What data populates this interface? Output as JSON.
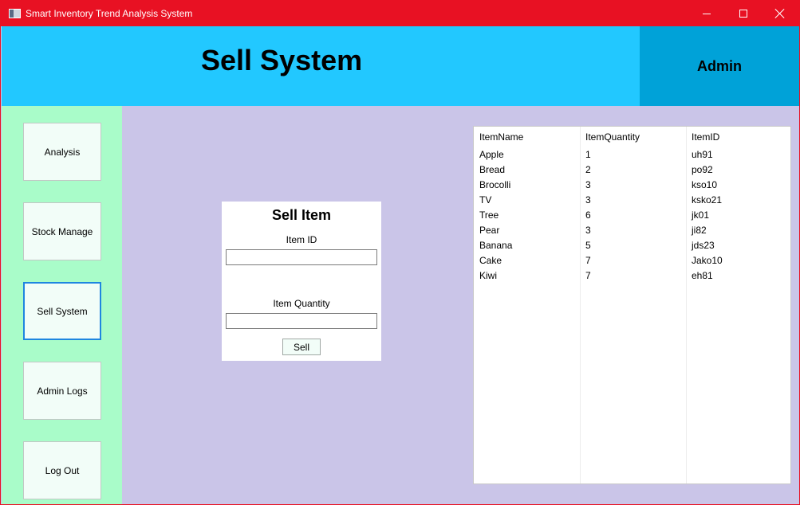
{
  "window": {
    "title": "Smart Inventory Trend Analysis System"
  },
  "header": {
    "title": "Sell System",
    "user_label": "Admin"
  },
  "sidebar": {
    "items": [
      {
        "label": "Analysis"
      },
      {
        "label": "Stock Manage"
      },
      {
        "label": "Sell System",
        "active": true
      },
      {
        "label": "Admin Logs"
      },
      {
        "label": "Log Out"
      }
    ]
  },
  "sell_form": {
    "title": "Sell Item",
    "item_id_label": "Item ID",
    "item_id_value": "",
    "item_quantity_label": "Item Quantity",
    "item_quantity_value": "",
    "sell_button_label": "Sell"
  },
  "inventory_table": {
    "columns": [
      "ItemName",
      "ItemQuantity",
      "ItemID"
    ],
    "rows": [
      [
        "Apple",
        "1",
        "uh91"
      ],
      [
        "Bread",
        "2",
        "po92"
      ],
      [
        "Brocolli",
        "3",
        "kso10"
      ],
      [
        "TV",
        "3",
        "ksko21"
      ],
      [
        "Tree",
        "6",
        "jk01"
      ],
      [
        "Pear",
        "3",
        "ji82"
      ],
      [
        "Banana",
        "5",
        "jds23"
      ],
      [
        "Cake",
        "7",
        "Jako10"
      ],
      [
        "Kiwi",
        "7",
        "eh81"
      ]
    ]
  },
  "colors": {
    "titlebar": "#e81123",
    "header": "#22c8ff",
    "admin_panel": "#00a2d8",
    "sidebar": "#a9fcc9",
    "content": "#cac5e8",
    "active_nav_border": "#1f86e0"
  },
  "icons": {
    "app": "app-window-icon",
    "minimize": "minimize-icon",
    "maximize": "maximize-icon",
    "close": "close-icon"
  }
}
